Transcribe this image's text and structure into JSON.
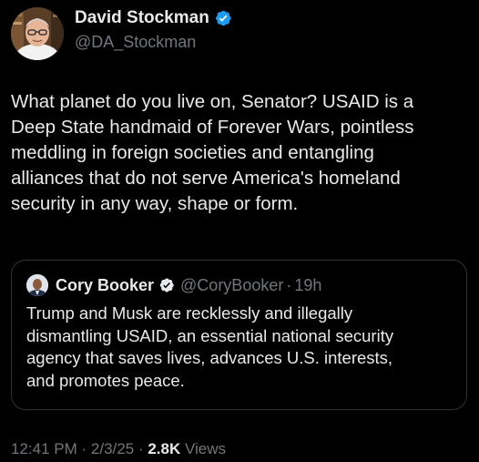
{
  "author": {
    "name": "David Stockman",
    "handle": "@DA_Stockman",
    "verified_icon": "verified-badge-icon"
  },
  "tweet": {
    "text": "What planet do you live on, Senator? USAID is a\nDeep State handmaid of Forever Wars, pointless\nmeddling in foreign societies and entangling\nalliances that do not serve America's homeland\nsecurity in any way, shape or form."
  },
  "quote": {
    "name": "Cory Booker",
    "handle": "@CoryBooker",
    "separator": "·",
    "time": "19h",
    "text": "Trump and Musk are recklessly and illegally\ndismantling USAID, an essential national security\nagency that saves lives, advances U.S. interests,\nand promotes peace."
  },
  "meta": {
    "time": "12:41 PM",
    "date": "2/3/25",
    "separator": "·",
    "views_count": "2.8K",
    "views_label": "Views"
  },
  "colors": {
    "background": "#000000",
    "text_primary": "#e7e9ea",
    "text_secondary": "#71767b",
    "verified_blue": "#1d9bf0",
    "border": "#2f3336"
  }
}
